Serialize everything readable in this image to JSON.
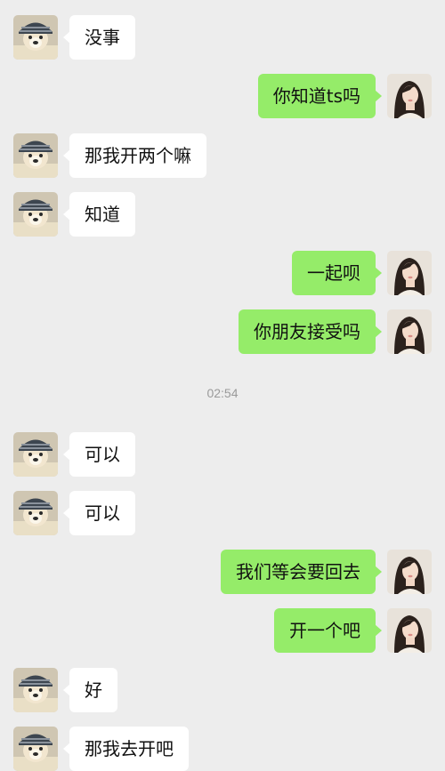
{
  "colors": {
    "background": "#ededed",
    "incoming_bubble": "#ffffff",
    "outgoing_bubble": "#95ec69",
    "timestamp_text": "#9a9a9a"
  },
  "avatars": {
    "contact": "dog-avatar-icon",
    "self": "woman-avatar-icon"
  },
  "messages": [
    {
      "side": "left",
      "text": "没事"
    },
    {
      "side": "right",
      "text": "你知道ts吗"
    },
    {
      "side": "left",
      "text": "那我开两个嘛"
    },
    {
      "side": "left",
      "text": "知道"
    },
    {
      "side": "right",
      "text": "一起呗"
    },
    {
      "side": "right",
      "text": "你朋友接受吗"
    },
    {
      "side": "left",
      "text": "可以"
    },
    {
      "side": "left",
      "text": "可以"
    },
    {
      "side": "right",
      "text": "我们等会要回去"
    },
    {
      "side": "right",
      "text": "开一个吧"
    },
    {
      "side": "left",
      "text": "好"
    },
    {
      "side": "left",
      "text": "那我去开吧"
    }
  ],
  "timestamp": "02:54"
}
